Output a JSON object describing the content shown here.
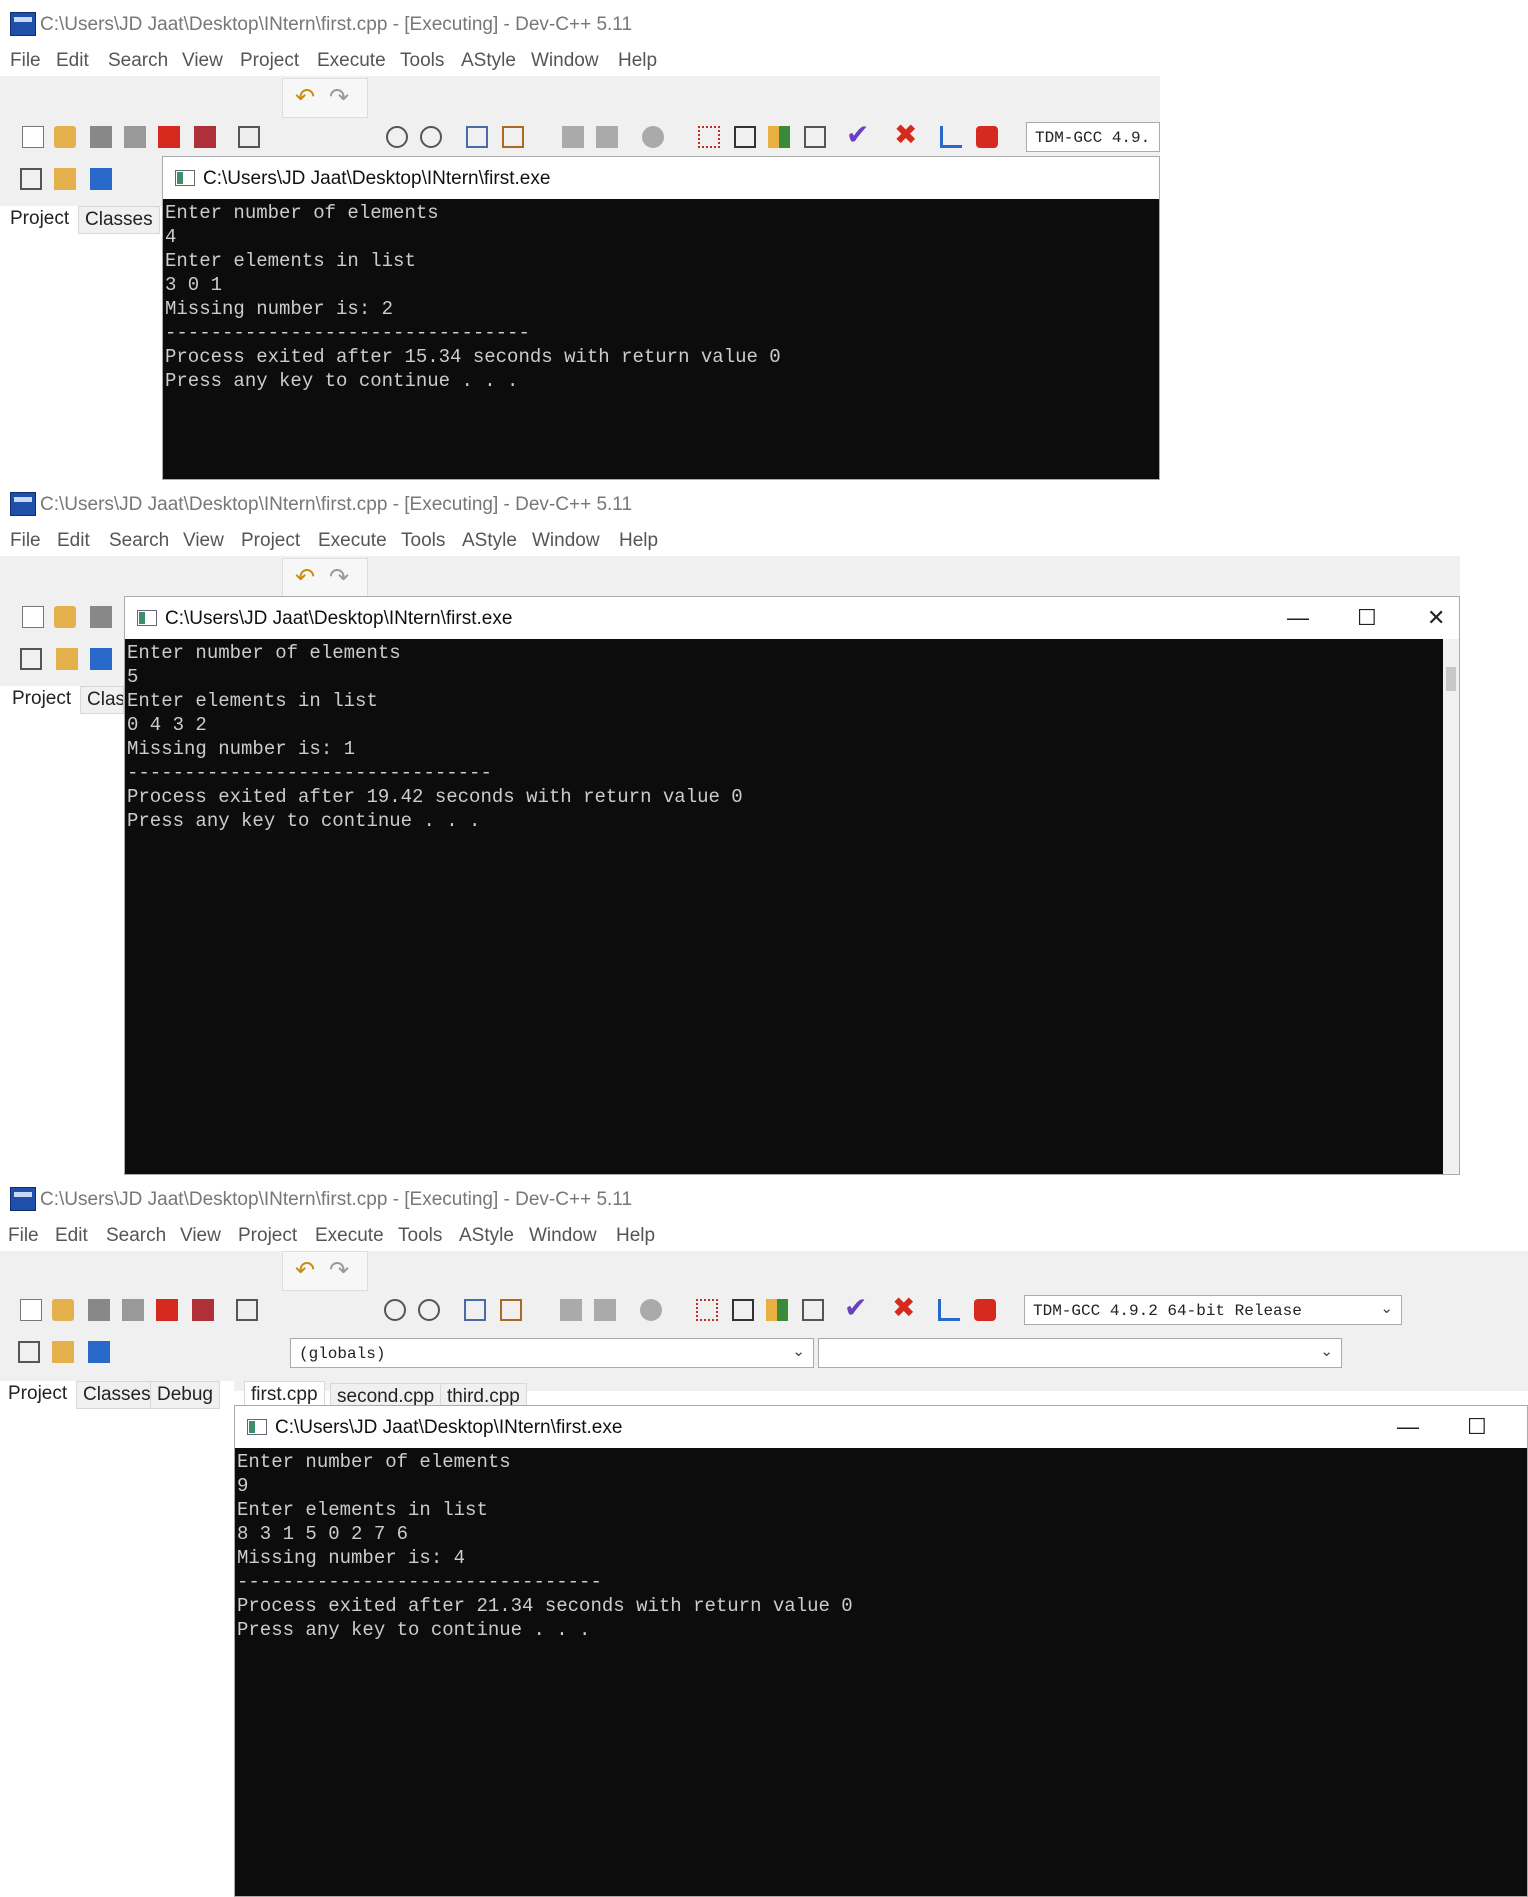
{
  "app": {
    "title": "C:\\Users\\JD Jaat\\Desktop\\INtern\\first.cpp - [Executing] - Dev-C++ 5.11",
    "menu": [
      "File",
      "Edit",
      "Search",
      "View",
      "Project",
      "Execute",
      "Tools",
      "AStyle",
      "Window",
      "Help"
    ],
    "panel_tabs": [
      "Project",
      "Classes",
      "Debug"
    ],
    "panel_tab_partial": "Class",
    "compiler": "TDM-GCC 4.9.2 64-bit Release",
    "compiler_partial": "TDM-GCC 4.9.",
    "scope_combo": "(globals)",
    "file_tabs": [
      "first.cpp",
      "second.cpp",
      "third.cpp"
    ]
  },
  "icons": {
    "toolbar_undo": "undo-icon",
    "toolbar_redo": "redo-icon",
    "check": "check-icon",
    "stop": "stop-icon",
    "chart": "chart-icon"
  },
  "colors": {
    "console_bg": "#0c0c0c",
    "console_fg": "#cccccc",
    "accent_red": "#d62a1e",
    "accent_green": "#3aa53a",
    "accent_blue": "#2868c8"
  },
  "console_title": "C:\\Users\\JD Jaat\\Desktop\\INtern\\first.exe",
  "runs": [
    {
      "lines": [
        "Enter number of elements",
        "4",
        "Enter elements in list",
        "3 0 1",
        "Missing number is: 2",
        "--------------------------------",
        "Process exited after 15.34 seconds with return value 0",
        "Press any key to continue . . ."
      ]
    },
    {
      "lines": [
        "Enter number of elements",
        "5",
        "Enter elements in list",
        "0 4 3 2",
        "Missing number is: 1",
        "--------------------------------",
        "Process exited after 19.42 seconds with return value 0",
        "Press any key to continue . . ."
      ]
    },
    {
      "lines": [
        "Enter number of elements",
        "9",
        "Enter elements in list",
        "8 3 1 5 0 2 7 6",
        "Missing number is: 4",
        "--------------------------------",
        "Process exited after 21.34 seconds with return value 0",
        "Press any key to continue . . ."
      ]
    }
  ],
  "window_controls": {
    "minimize": "—",
    "maximize": "☐",
    "close": "✕"
  }
}
